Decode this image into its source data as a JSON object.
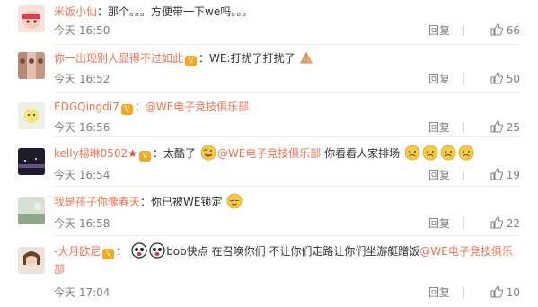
{
  "comments": [
    {
      "user": "米饭小仙",
      "text": "：那个。。。方便带一下we吗。。。",
      "time": "今天 16:50",
      "reply": "回复",
      "likes": "66"
    },
    {
      "user": "你一出现别人显得不过如此",
      "text": "：WE:打扰了打扰了",
      "time": "今天 16:52",
      "reply": "回复",
      "likes": "50"
    },
    {
      "user": "EDGQingdi7",
      "text": "：",
      "mention": "@WE电子竞技俱乐部",
      "time": "今天 16:56",
      "reply": "回复",
      "likes": "25"
    },
    {
      "user": "kelly楊琳0502",
      "text": "：太酷了",
      "mention": "@WE电子竞技俱乐部",
      "text2": " 你看看人家排场",
      "time": "今天 16:54",
      "reply": "回复",
      "likes": "19"
    },
    {
      "user": "我是孩子你像春天",
      "text": "：你已被WE锁定",
      "time": "今天 16:58",
      "reply": "回复",
      "likes": "22"
    },
    {
      "user": "-大月欧尼",
      "text": "：",
      "text2": "bob快点 在召唤你们 不让你们走路让你们坐游艇蹭饭",
      "mention": "@WE电子竞技俱乐部",
      "time": "今天 17:04",
      "reply": "回复",
      "likes": "10"
    }
  ],
  "badge": "V",
  "fire_badge": "★"
}
